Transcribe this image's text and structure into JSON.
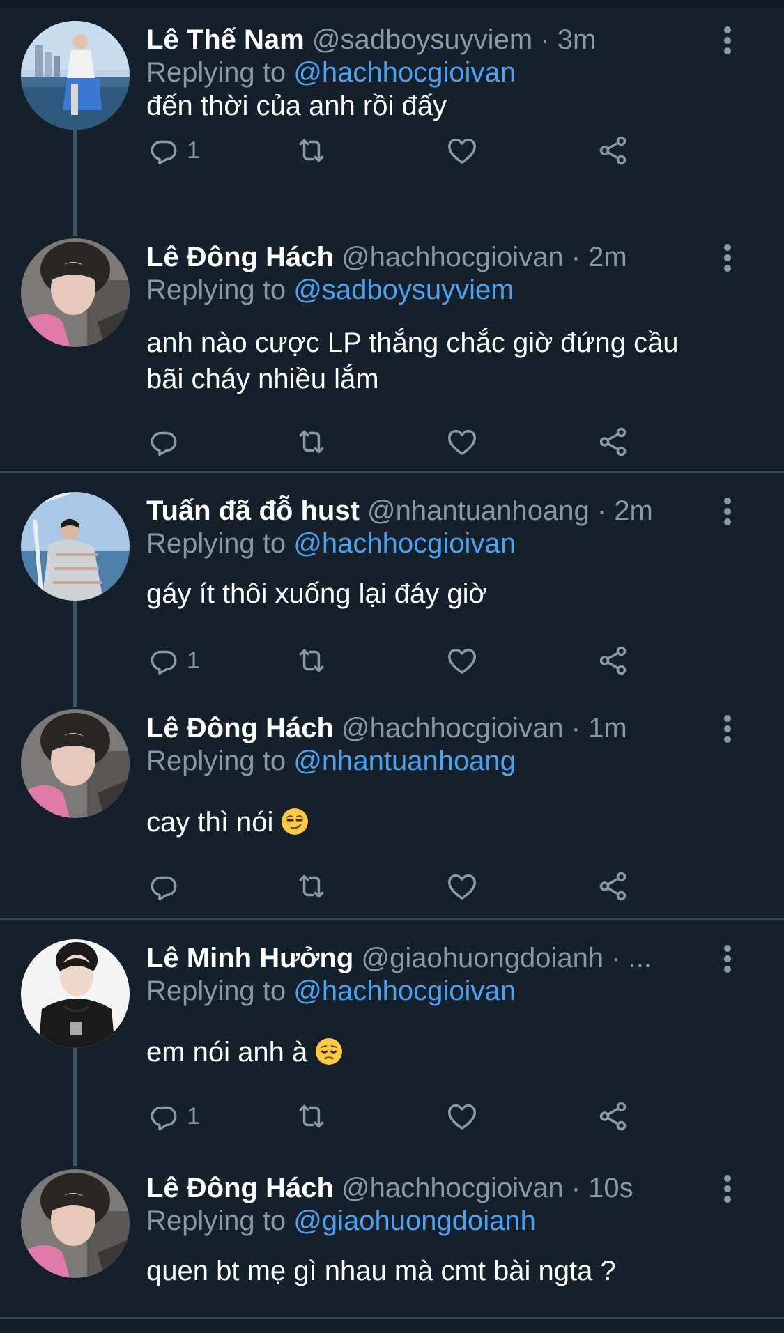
{
  "tweets": [
    {
      "name": "Lê Thế Nam",
      "handle": "@sadboysuyviem",
      "time": "· 3m",
      "replying_label": "Replying to",
      "replying_to": "@hachhocgioivan",
      "text": "đến thời của anh rồi đấy",
      "reply_count": "1"
    },
    {
      "name": "Lê Đông Hách",
      "handle": "@hachhocgioivan",
      "time": "· 2m",
      "replying_label": "Replying to",
      "replying_to": "@sadboysuyviem",
      "text_line1": "anh nào cược LP thắng chắc giờ đứng cầu",
      "text_line2": "bãi cháy nhiều lắm",
      "reply_count": ""
    },
    {
      "name": "Tuấn đã đỗ hust",
      "handle": "@nhantuanhoang",
      "time": "· 2m",
      "replying_label": "Replying to",
      "replying_to": "@hachhocgioivan",
      "text": "gáy ít thôi xuống lại đáy giờ",
      "reply_count": "1"
    },
    {
      "name": "Lê Đông Hách",
      "handle": "@hachhocgioivan",
      "time": "· 1m",
      "replying_label": "Replying to",
      "replying_to": "@nhantuanhoang",
      "text": "cay thì nói",
      "emoji": "smirking-face",
      "reply_count": ""
    },
    {
      "name": "Lê Minh Hưởng",
      "handle": "@giaohuongdoianh",
      "time": "· ...",
      "replying_label": "Replying to",
      "replying_to": "@hachhocgioivan",
      "text": "em nói anh à",
      "emoji": "pensive-face",
      "reply_count": "1"
    },
    {
      "name": "Lê Đông Hách",
      "handle": "@hachhocgioivan",
      "time": "· 10s",
      "replying_label": "Replying to",
      "replying_to": "@giaohuongdoianh",
      "text": "quen bt mẹ gì nhau mà cmt bài ngta ?",
      "reply_count": ""
    }
  ],
  "colors": {
    "background": "#15202b",
    "text": "#ffffff",
    "secondary": "#8b98a5",
    "link": "#4da2f0",
    "divider": "#38444d"
  },
  "icons": [
    "reply-icon",
    "retweet-icon",
    "like-icon",
    "share-icon",
    "more-options-icon"
  ]
}
